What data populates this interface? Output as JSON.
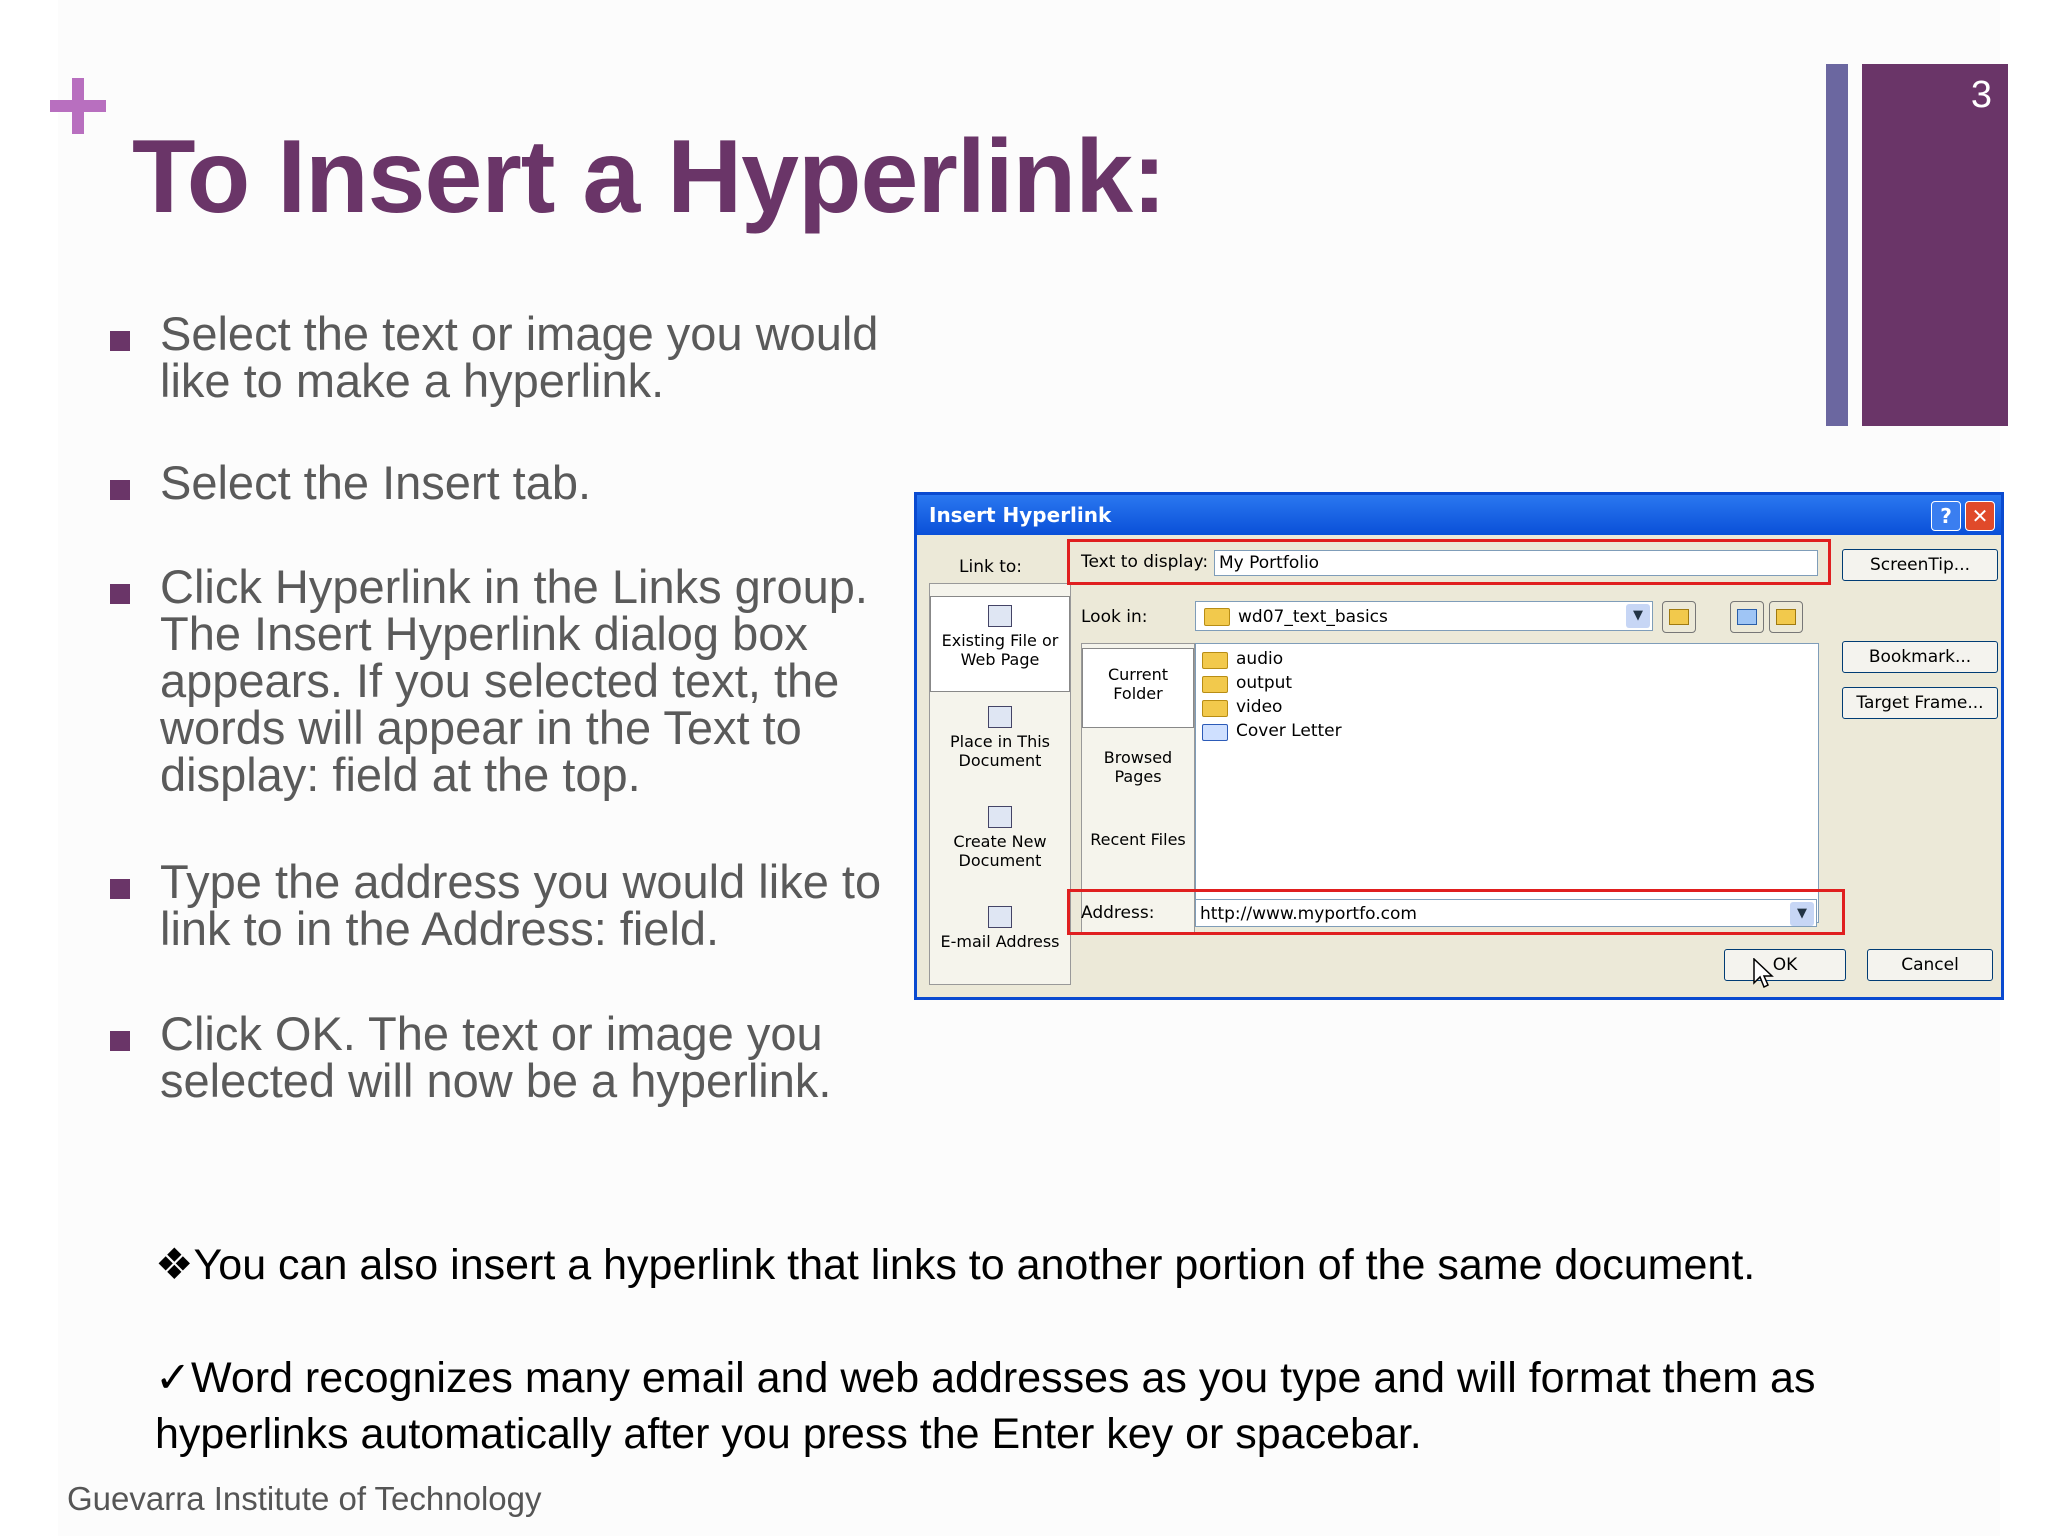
{
  "slide": {
    "title": "To Insert a Hyperlink:",
    "page_number": "3",
    "bullets": [
      "Select the text or image you would like to make a hyperlink.",
      "Select the Insert tab.",
      "Click Hyperlink in the Links group. The Insert Hyperlink dialog box appears. If you selected text, the words will appear in the Text to display: field at the top.",
      "Type the address you would like to link to in the Address: field.",
      "Click OK. The text or image you selected will now be a hyperlink."
    ],
    "note1": "❖You can also insert a hyperlink that links to another portion of the same document.",
    "note2": "✓Word recognizes many email and web addresses as you type and will format them as hyperlinks automatically after you press the Enter key or spacebar.",
    "footer": "Guevarra Institute of Technology"
  },
  "dialog": {
    "title": "Insert Hyperlink",
    "help_glyph": "?",
    "close_glyph": "✕",
    "link_to_label": "Link to:",
    "link_to_items": [
      "Existing File or Web Page",
      "Place in This Document",
      "Create New Document",
      "E-mail Address"
    ],
    "text_to_display_label": "Text to display:",
    "text_to_display_value": "My Portfolio",
    "screentip_label": "ScreenTip...",
    "look_in_label": "Look in:",
    "look_in_value": "wd07_text_basics",
    "left_tabs": [
      "Current Folder",
      "Browsed Pages",
      "Recent Files"
    ],
    "files": [
      "audio",
      "output",
      "video",
      "Cover Letter"
    ],
    "bookmark_label": "Bookmark...",
    "target_frame_label": "Target Frame...",
    "address_label": "Address:",
    "address_value": "http://www.myportfo.com",
    "ok_label": "OK",
    "cancel_label": "Cancel"
  },
  "colors": {
    "accent_purple": "#6a3568",
    "plus_pink": "#b86fbf",
    "bar_blue": "#6b67a0",
    "highlight_red": "#e01f1f",
    "xp_title_blue": "#0a50d8"
  }
}
